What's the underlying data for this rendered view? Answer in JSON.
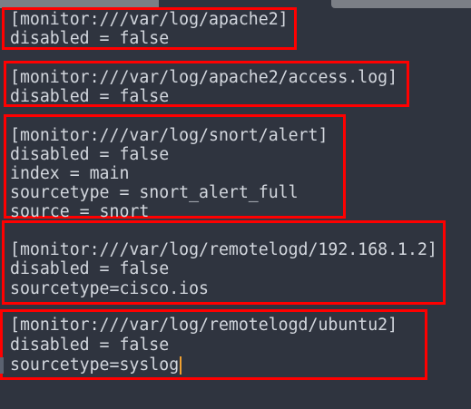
{
  "blocks": [
    {
      "lines": [
        "[monitor:///var/log/apache2]",
        "disabled = false"
      ]
    },
    {
      "lines": [
        "[monitor:///var/log/apache2/access.log]",
        "disabled = false"
      ]
    },
    {
      "lines": [
        "[monitor:///var/log/snort/alert]",
        "disabled = false",
        "index = main",
        "sourcetype = snort_alert_full",
        "source = snort"
      ]
    },
    {
      "lines": [
        "[monitor:///var/log/remotelogd/192.168.1.2]",
        "disabled = false",
        "sourcetype=cisco.ios"
      ]
    },
    {
      "lines": [
        "[monitor:///var/log/remotelogd/ubuntu2]",
        "disabled = false",
        "sourcetype=syslog"
      ]
    }
  ],
  "colors": {
    "highlight": "#ff0000",
    "background": "#2f343f",
    "text": "#d3d7de",
    "caret": "#f0a030"
  }
}
